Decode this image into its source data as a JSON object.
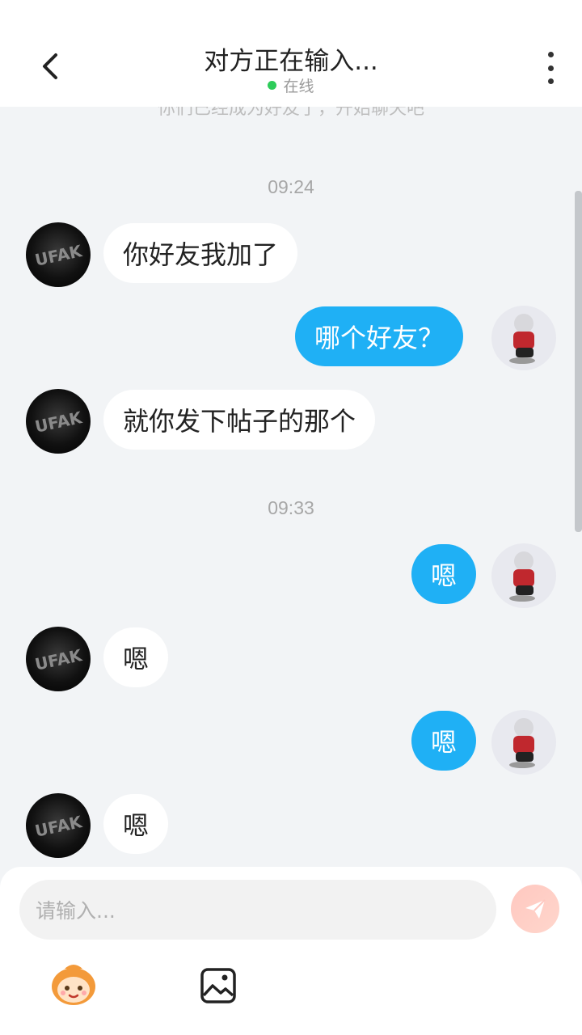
{
  "header": {
    "title": "对方正在输入...",
    "status": "在线",
    "status_color": "#2ecc5a"
  },
  "notice": "你们已经成为好友了，开始聊天吧",
  "timestamps": [
    "09:24",
    "09:33"
  ],
  "messages": [
    {
      "side": "in",
      "text": "你好友我加了"
    },
    {
      "side": "out",
      "text": "哪个好友？"
    },
    {
      "side": "in",
      "text": "就你发下帖子的那个"
    },
    {
      "side": "out",
      "text": "嗯"
    },
    {
      "side": "in",
      "text": "嗯"
    },
    {
      "side": "out",
      "text": "嗯"
    },
    {
      "side": "in",
      "text": "嗯"
    }
  ],
  "input": {
    "placeholder": "请输入..."
  },
  "icons": {
    "back": "chevron-left-icon",
    "more": "more-vertical-icon",
    "send": "send-icon",
    "emoji": "emoji-icon",
    "image": "image-icon"
  },
  "colors": {
    "outgoing_bubble": "#1fb0f5",
    "incoming_bubble": "#ffffff",
    "background": "#f2f4f6"
  }
}
